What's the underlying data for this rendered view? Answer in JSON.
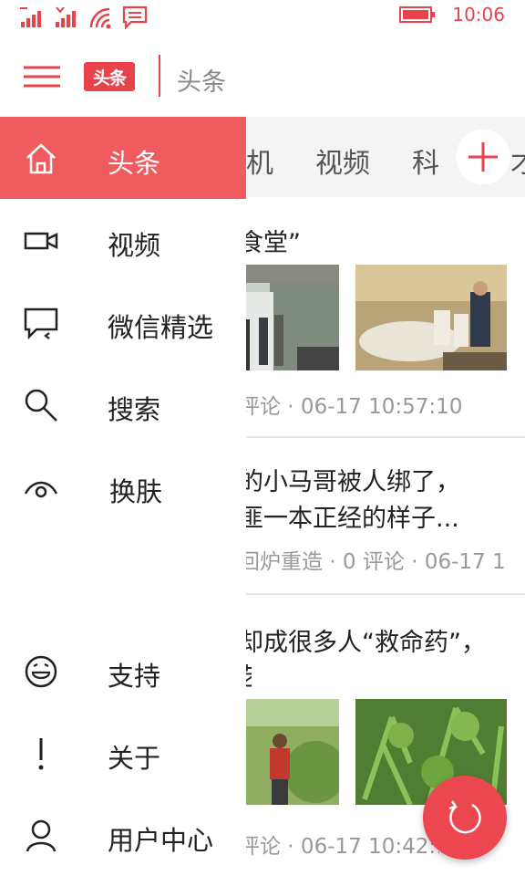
{
  "status": {
    "time": "10:06"
  },
  "app_bar": {
    "logo_text": "头条",
    "title": "头条"
  },
  "tabs": {
    "visible": [
      "机",
      "视频",
      "科",
      "才"
    ]
  },
  "articles": [
    {
      "title_lines": [
        "食堂”"
      ],
      "meta": "评论 · 06-17 10:57:10",
      "thumbnails": [
        "balcony-photo",
        "banquet-room-photo"
      ]
    },
    {
      "title_lines": [
        "的小马哥被人绑了，",
        "匪一本正经的样子..."
      ],
      "meta": "回炉重造 · 0 评论 · 06-17 1"
    },
    {
      "title_lines": [
        "却成很多人“救命药”，",
        "艺"
      ],
      "meta": "评论 · 06-17 10:42:1",
      "thumbnails": [
        "man-in-bushes-photo",
        "green-plant-photo"
      ]
    }
  ],
  "drawer": {
    "items": [
      {
        "label": "头条",
        "icon": "home-icon",
        "active": true
      },
      {
        "label": "视频",
        "icon": "video-camera-icon"
      },
      {
        "label": "微信精选",
        "icon": "chat-bubble-icon"
      },
      {
        "label": "搜索",
        "icon": "search-icon"
      },
      {
        "label": "换肤",
        "icon": "eye-icon"
      },
      {
        "label": "支持",
        "icon": "smiley-icon"
      },
      {
        "label": "关于",
        "icon": "exclamation-icon"
      },
      {
        "label": "用户中心",
        "icon": "user-icon"
      }
    ]
  },
  "colors": {
    "accent": "#e8434b",
    "drawer_active": "#ef5b5f",
    "fab": "#ec4651"
  }
}
